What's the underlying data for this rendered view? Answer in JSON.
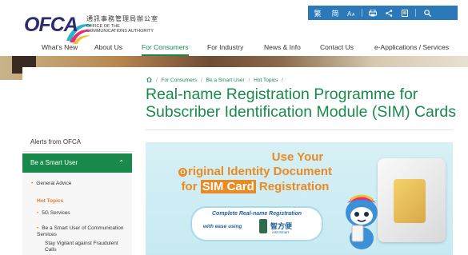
{
  "header": {
    "logo_text": "OFCA",
    "logo_chinese": "通訊事務管理局辦公室",
    "logo_english": "OFFICE OF THE\nCOMMUNICATIONS AUTHORITY",
    "toolbar": [
      "繁",
      "简",
      "A",
      "🖶",
      "<",
      "▤",
      "🔍"
    ]
  },
  "nav": {
    "items": [
      "What's New",
      "About Us",
      "For Consumers",
      "For Industry",
      "News & Info",
      "Contact Us",
      "e-Applications / Services"
    ],
    "active": "For Consumers"
  },
  "breadcrumb": {
    "home_icon": "home-icon",
    "items": [
      "For Consumers",
      "Be a Smart User",
      "Hot Topics"
    ]
  },
  "page": {
    "title": "Real-name Registration Programme for Subscriber Identification Module (SIM) Cards"
  },
  "sidebar": {
    "alerts": "Alerts from OFCA",
    "active_section": "Be a Smart User",
    "sub_items": {
      "general": "General Advice",
      "hot": "Hot Topics",
      "fiveg": "5G Services",
      "smart_comm": "Be a Smart User of Communication Services",
      "vigilant": "Stay Vigilant against Fraudulent Calls"
    }
  },
  "hero": {
    "line1": "Use Your",
    "line2_prefix": "O",
    "line2": "riginal Identity Document",
    "line3_pre": "for ",
    "line3_highlight": "SIM Card",
    "line3_post": " Registration",
    "bubble1": "Complete Real-name Registration",
    "bubble2_pre": "with ease using",
    "iam": "智方便",
    "iam_sub": "iAM Smart"
  },
  "colors": {
    "brand_green": "#1a8a4c",
    "toolbar_blue": "#2b79b9",
    "accent_orange": "#e98a22"
  }
}
